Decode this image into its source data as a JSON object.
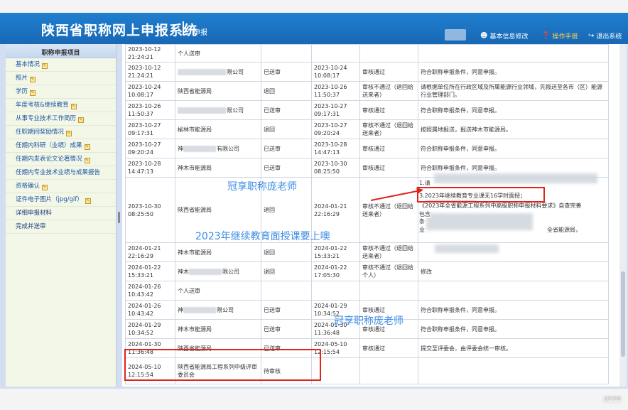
{
  "header": {
    "title": "陕西省职称网上申报系统",
    "subtitle": "申报",
    "nav": [
      {
        "icon": "user-icon",
        "label": "基本信息修改"
      },
      {
        "icon": "help-icon",
        "label": "操作手册"
      },
      {
        "icon": "logout-icon",
        "label": "退出系统"
      }
    ]
  },
  "sidebar": {
    "title": "职称申报项目",
    "items": [
      {
        "label": "基本情况",
        "edit": true
      },
      {
        "label": "照片",
        "edit": true
      },
      {
        "label": "学历",
        "edit": true
      },
      {
        "label": "年度考核&继续教育",
        "edit": true
      },
      {
        "label": "从事专业技术工作简历",
        "edit": true
      },
      {
        "label": "任职期间奖励情况",
        "edit": true
      },
      {
        "label": "任期内科研（业绩）成果",
        "edit": true
      },
      {
        "label": "任期内发表论文论著情况",
        "edit": true
      },
      {
        "label": "任期内专业技术业绩与成果报告",
        "edit": false
      },
      {
        "label": "资格确认",
        "edit": true
      },
      {
        "label": "证件电子图片（jpg/gif）",
        "edit": true
      },
      {
        "label": "详细申报材料",
        "edit": false
      },
      {
        "label": "完成并送审",
        "edit": false
      }
    ]
  },
  "rows": [
    {
      "t1": "2023-10-12 21:24:21",
      "org": "个人送审",
      "blur": "",
      "st": "",
      "t2": "",
      "res": "",
      "op": ""
    },
    {
      "t1": "2023-10-12 21:24:21",
      "org": "限公司",
      "blur": "l",
      "st": "已送审",
      "t2": "2023-10-24 10:08:17",
      "res": "审核通过",
      "op": "符合职称申报条件，同意申报。"
    },
    {
      "t1": "2023-10-24 10:08:17",
      "org": "陕西省能源局",
      "blur": "",
      "st": "退回",
      "t2": "2023-10-26 11:50:37",
      "res": "审核不通过（退回给送来者）",
      "op": "请根据单位所在行政区域及所属能源行业领域，先报送至各市（区）能源行业管理部门。"
    },
    {
      "t1": "2023-10-26 11:50:37",
      "org": "限公司",
      "blur": "l",
      "st": "已送审",
      "t2": "2023-10-27 09:17:31",
      "res": "审核通过",
      "op": "符合职称申报条件，同意申报。"
    },
    {
      "t1": "2023-10-27 09:17:31",
      "org": "榆林市能源局",
      "blur": "",
      "st": "退回",
      "t2": "2023-10-27 09:20:24",
      "res": "审核不通过（退回给送来者）",
      "op": "按照属地报送，报送神木市能源局。"
    },
    {
      "t1": "2023-10-27 09:20:24",
      "org": "有限公司",
      "blur": "p",
      "pre": "神",
      "st": "已送审",
      "t2": "2023-10-28 14:47:13",
      "res": "审核通过",
      "op": "符合职称申报条件，同意申报。"
    },
    {
      "t1": "2023-10-28 14:47:13",
      "org": "神木市能源局",
      "blur": "",
      "st": "已送审",
      "t2": "2023-10-30 08:25:50",
      "res": "审核通过",
      "op": "符合职称申报条件，同意申报。"
    },
    {
      "t1": "2023-10-30 08:25:50",
      "org": "陕西省能源局",
      "blur": "",
      "st": "退回",
      "t2": "2024-01-21 22:16:29",
      "res": "审核不通过（退回给送来者）",
      "op": "",
      "tall": true
    },
    {
      "t1": "2024-01-21 22:16:29",
      "org": "神木市能源局",
      "blur": "",
      "st": "退回",
      "t2": "2024-01-22 15:33:21",
      "res": "审核不通过（退回给送来者）",
      "op": "",
      "opblur": true
    },
    {
      "t1": "2024-01-22 15:33:21",
      "org": "限公司",
      "blur": "p",
      "pre": "神木",
      "st": "退回",
      "t2": "2024-01-22 17:05:30",
      "res": "审核不通过（退回给个人）",
      "op": "修改"
    },
    {
      "t1": "2024-01-26 10:43:42",
      "org": "个人送审",
      "blur": "",
      "st": "",
      "t2": "",
      "res": "",
      "op": ""
    },
    {
      "t1": "2024-01-26 10:43:42",
      "org": "限公司",
      "blur": "p",
      "pre": "神",
      "st": "已送审",
      "t2": "2024-01-29 10:34:52",
      "res": "审核通过",
      "op": "符合职称申报条件，同意申报。"
    },
    {
      "t1": "2024-01-29 10:34:52",
      "org": "神木市能源局",
      "blur": "",
      "st": "已送审",
      "t2": "2024-01-30 11:36:48",
      "res": "审核通过",
      "op": "符合职称申报条件，同意申报。"
    },
    {
      "t1": "2024-01-30 11:36:48",
      "org": "陕西省能源局",
      "blur": "",
      "st": "已送审",
      "t2": "2024-05-10 12:15:54",
      "res": "审核通过",
      "op": "提交至评委会，由评委会统一审核。"
    },
    {
      "t1": "2024-05-10 12:15:54",
      "org": "陕西省能源局工程系列中级评审委员会",
      "blur": "",
      "st": "待审核",
      "t2": "",
      "res": "",
      "op": ""
    }
  ],
  "tall_row_notes": {
    "line1": "1.请",
    "line2": "3.2023年继续教育专业课无16学时面授；",
    "line3": "《2023年全省能源工程系列中高级职称申报材料要求》自查完善",
    "line4": "包含",
    "line5": "条",
    "line6": "业",
    "tail": "全省能源局，"
  },
  "watermarks": [
    {
      "text": "冠享职称庞老师"
    },
    {
      "text": "2023年继续教育面授课要上噢"
    },
    {
      "text": "冠享职称庞老师"
    }
  ],
  "footer_badge": "返回顶部",
  "colors": {
    "header": "#1b72c2",
    "annotation": "#e0241b",
    "watermark": "#3d8be6",
    "manual": "#ffd64d"
  }
}
